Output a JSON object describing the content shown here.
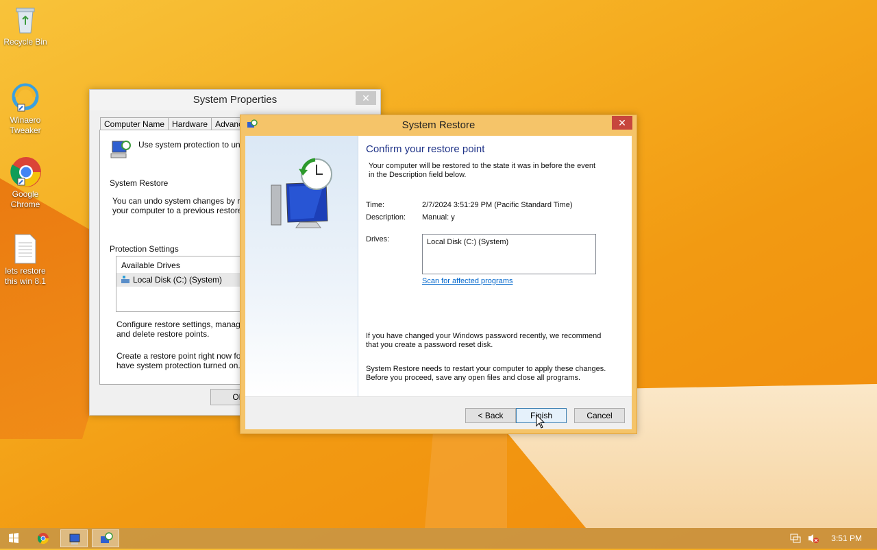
{
  "desktop": {
    "icons": [
      {
        "label": "Recycle Bin",
        "icon": "recycle-bin-icon"
      },
      {
        "label": "Winaero Tweaker",
        "icon": "winaero-tweaker-icon"
      },
      {
        "label": "Google Chrome",
        "icon": "chrome-icon"
      },
      {
        "label": "lets restore this win 8.1",
        "icon": "text-file-icon"
      }
    ]
  },
  "system_properties": {
    "title": "System Properties",
    "close": "✕",
    "tabs": [
      "Computer Name",
      "Hardware",
      "Advanced"
    ],
    "intro": "Use system protection to undo u",
    "system_restore_heading": "System Restore",
    "system_restore_text_1": "You can undo system changes by rever",
    "system_restore_text_2": "your computer to a previous restore poin",
    "protection_heading": "Protection Settings",
    "available_drives": "Available Drives",
    "drive": "Local Disk (C:) (System)",
    "configure_1": "Configure restore settings, manage disk",
    "configure_2": "and delete restore points.",
    "create_1": "Create a restore point right now for the",
    "create_2": "have system protection turned on.",
    "ok": "OK"
  },
  "system_restore": {
    "title": "System Restore",
    "close": "✕",
    "heading": "Confirm your restore point",
    "intro_1": "Your computer will be restored to the state it was in before the event",
    "intro_2": "in the Description field below.",
    "time_label": "Time:",
    "time_value": "2/7/2024 3:51:29 PM (Pacific Standard Time)",
    "description_label": "Description:",
    "description_value": "Manual: y",
    "drives_label": "Drives:",
    "drives_value": "Local Disk (C:) (System)",
    "scan_link": "Scan for affected programs",
    "password_1": "If you have changed your Windows password recently, we recommend",
    "password_2": "that you create a password reset disk.",
    "restart_1": "System Restore needs to restart your computer to apply these changes.",
    "restart_2": "Before you proceed, save any open files and close all programs.",
    "back": "< Back",
    "finish": "Finish",
    "cancel": "Cancel"
  },
  "taskbar": {
    "items": [
      "start-icon",
      "chrome-icon",
      "system-properties-icon",
      "system-restore-icon"
    ],
    "clock": "3:51 PM"
  }
}
